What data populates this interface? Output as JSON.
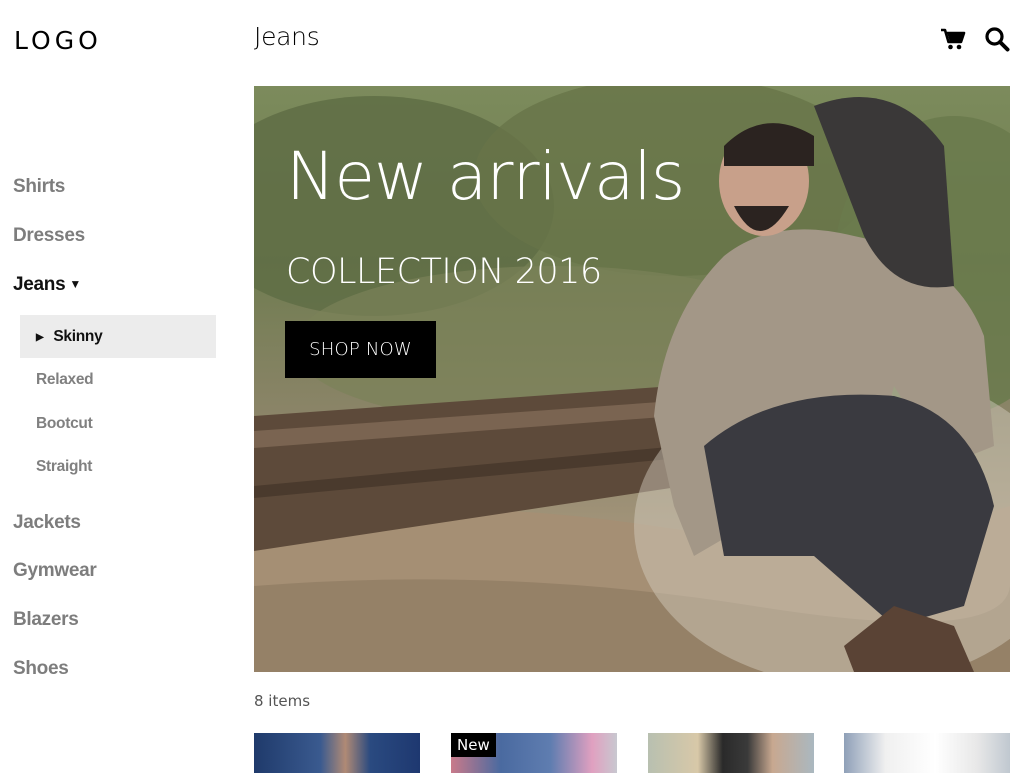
{
  "header": {
    "logo": "LOGO",
    "title": "Jeans",
    "icons": [
      "cart-icon",
      "search-icon"
    ]
  },
  "sidebar": {
    "categories_top": [
      {
        "label": "Shirts"
      },
      {
        "label": "Dresses"
      },
      {
        "label": "Jeans",
        "active": true
      }
    ],
    "subcategories": [
      {
        "label": "Skinny",
        "active": true
      },
      {
        "label": "Relaxed"
      },
      {
        "label": "Bootcut"
      },
      {
        "label": "Straight"
      }
    ],
    "categories_bottom": [
      {
        "label": "Jackets"
      },
      {
        "label": "Gymwear"
      },
      {
        "label": "Blazers"
      },
      {
        "label": "Shoes"
      }
    ]
  },
  "hero": {
    "title": "New arrivals",
    "subtitle": "COLLECTION 2016",
    "cta": "SHOP NOW"
  },
  "listing": {
    "count": "8 items",
    "products": [
      {
        "badge": ""
      },
      {
        "badge": "New"
      },
      {
        "badge": ""
      },
      {
        "badge": ""
      }
    ]
  }
}
